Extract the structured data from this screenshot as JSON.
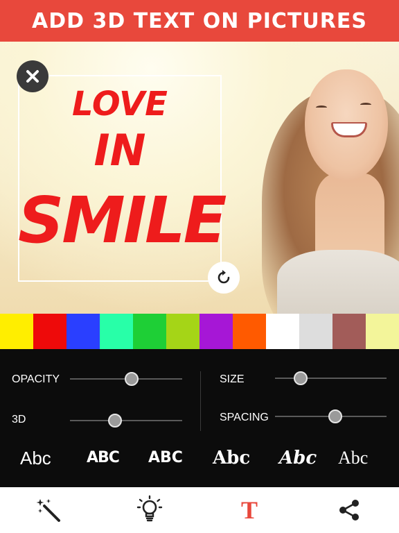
{
  "banner": {
    "title": "ADD 3D TEXT ON PICTURES"
  },
  "sticker": {
    "lines": [
      "LOVE",
      "IN",
      "SMILE"
    ],
    "color": "#ee1c1c",
    "close_icon": "close-icon",
    "rotate_icon": "rotate-icon"
  },
  "palette": {
    "colors": [
      "#ffee00",
      "#ee0a0a",
      "#2a3fff",
      "#28ffa8",
      "#1ecf36",
      "#a5d517",
      "#a617d6",
      "#ff5a00",
      "#ffffff",
      "#dddddd",
      "#a25c59",
      "#f3f59a"
    ]
  },
  "controls": {
    "opacity": {
      "label": "OPACITY",
      "value": 0.55
    },
    "depth_3d": {
      "label": "3D",
      "value": 0.4
    },
    "size": {
      "label": "SIZE",
      "value": 0.23
    },
    "spacing": {
      "label": "SPACING",
      "value": 0.54
    }
  },
  "fonts": {
    "samples": [
      "Abc",
      "ABC",
      "ABC",
      "Abc",
      "Abc",
      "Abc"
    ]
  },
  "toolbar": {
    "icons": [
      "magic-wand-icon",
      "idea-bulb-icon",
      "text-icon",
      "share-icon"
    ],
    "text_tool_label": "T",
    "active_color": "#e8483c"
  }
}
